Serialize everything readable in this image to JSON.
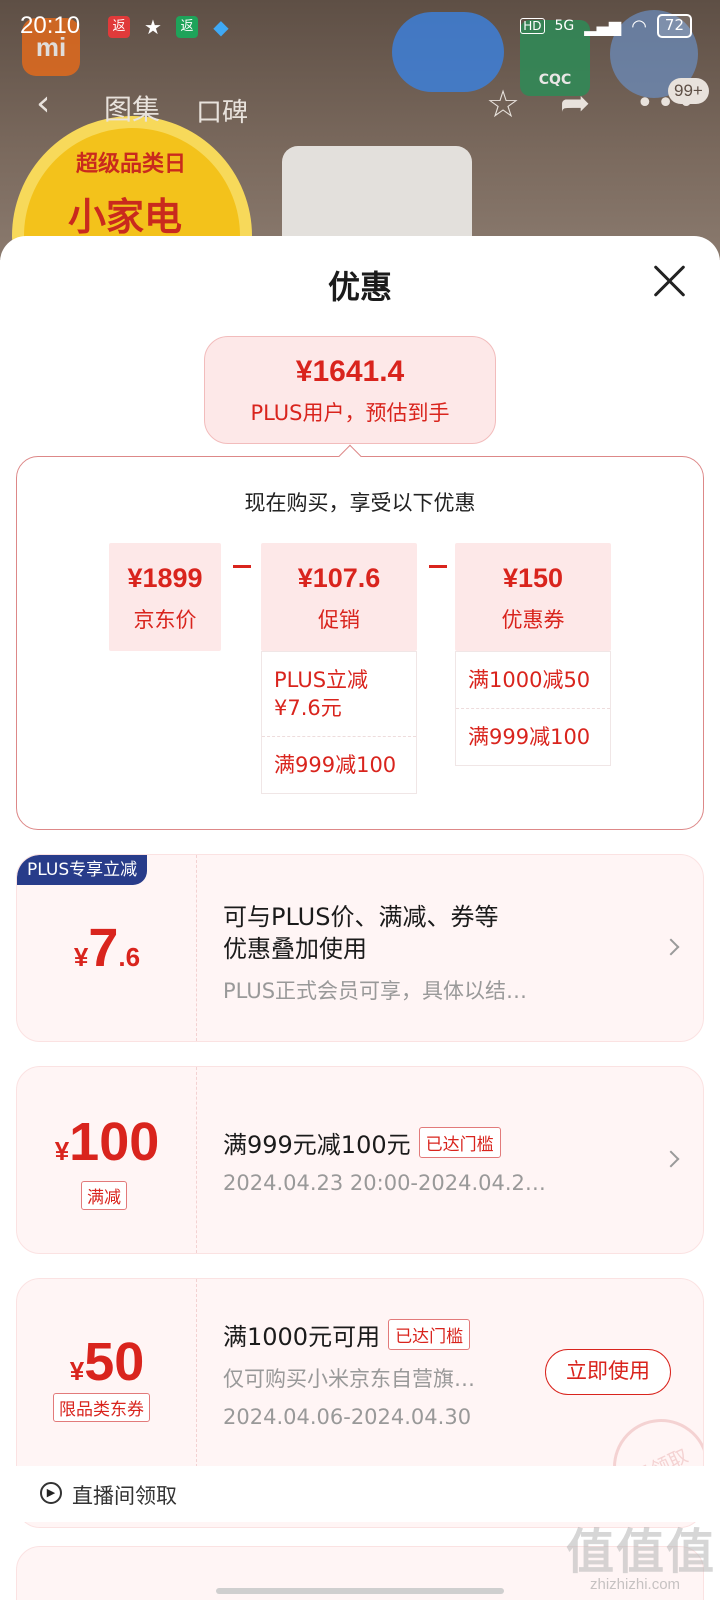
{
  "status_bar": {
    "time": "20:10",
    "network": "5G",
    "hd": "HD",
    "battery": "72"
  },
  "background_page": {
    "tabs": [
      "图集",
      "口碑"
    ],
    "message_badge": "99+",
    "promo_line1": "超级品类日",
    "promo_line2": "小家电",
    "cert_badge": "CQC"
  },
  "sheet": {
    "title": "优惠",
    "estimate": {
      "price": "¥1641.4",
      "label": "PLUS用户，预估到手"
    },
    "breakdown": {
      "title": "现在购买，享受以下优惠",
      "items": [
        {
          "amount": "¥1899",
          "label": "京东价"
        },
        {
          "amount": "¥107.6",
          "label": "促销"
        },
        {
          "amount": "¥150",
          "label": "优惠券"
        }
      ],
      "promo_details": [
        "PLUS立减\n¥7.6元",
        "满999减100"
      ],
      "coupon_details": [
        "满1000减50",
        "满999减100"
      ]
    },
    "cards": [
      {
        "ribbon": "PLUS专享立减",
        "currency": "¥",
        "amount_int": "7",
        "amount_dec": ".6",
        "line1": "可与PLUS价、满减、券等",
        "line2": "优惠叠加使用",
        "sub": "PLUS正式会员可享，具体以结…"
      },
      {
        "currency": "¥",
        "amount_int": "100",
        "tag": "满减",
        "title": "满999元减100元",
        "status": "已达门槛",
        "sub": "2024.04.23 20:00-2024.04.2…"
      },
      {
        "currency": "¥",
        "amount_int": "50",
        "tag": "限品类东券",
        "title": "满1000元可用",
        "status": "已达门槛",
        "sub1": "仅可购买小米京东自营旗…",
        "sub2": "2024.04.06-2024.04.30",
        "button": "立即使用",
        "stamp": "已领取"
      }
    ],
    "footnote": "直播间领取"
  },
  "watermark": {
    "main": "值值值",
    "sub": "zhizhizhi.com"
  },
  "colors": {
    "accent": "#d9241d",
    "soft_pink": "#fde8e8",
    "plus_blue": "#283c8a"
  }
}
